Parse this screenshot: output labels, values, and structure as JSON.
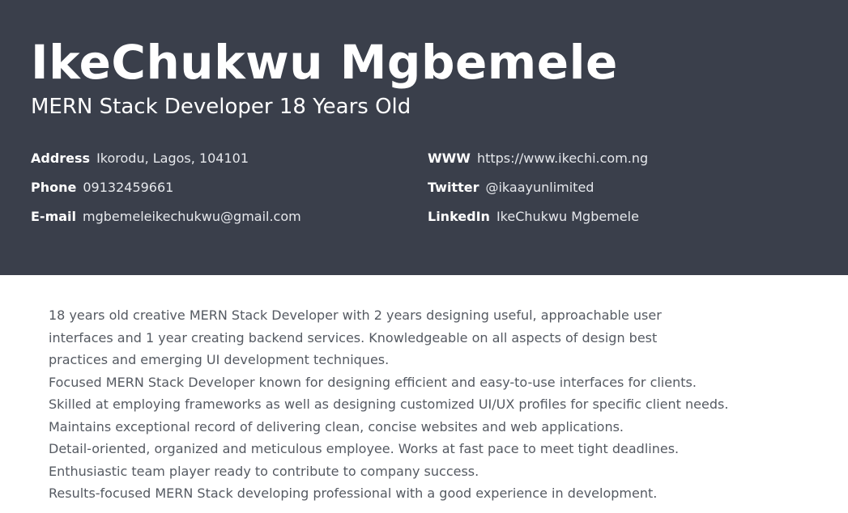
{
  "header": {
    "name": "IkeChukwu Mgbemele",
    "role": "MERN Stack Developer 18 Years Old",
    "background_color": "#3a3f4b",
    "contacts_left": [
      {
        "label": "Address",
        "value": "Ikorodu, Lagos, 104101"
      },
      {
        "label": "Phone",
        "value": "09132459661"
      },
      {
        "label": "E-mail",
        "value": "mgbemeleikechukwu@gmail.com"
      }
    ],
    "contacts_right": [
      {
        "label": "WWW",
        "value": "https://www.ikechi.com.ng"
      },
      {
        "label": "Twitter",
        "value": "@ikaayunlimited"
      },
      {
        "label": "LinkedIn",
        "value": "IkeChukwu Mgbemele"
      }
    ]
  },
  "summary": {
    "lines": [
      "18 years old creative MERN Stack Developer with 2 years designing useful, approachable user",
      "interfaces and 1 year creating backend services. Knowledgeable on all aspects of design best",
      "practices and emerging UI development techniques.",
      "Focused MERN Stack Developer known for designing efficient and easy-to-use interfaces for clients.",
      "Skilled at employing frameworks as well as designing customized UI/UX profiles for specific client needs.",
      "Maintains exceptional record of delivering clean, concise websites and web applications.",
      "Detail-oriented, organized and meticulous employee. Works at fast pace to meet tight deadlines.",
      "Enthusiastic team player ready to contribute to company success.",
      "Results-focused MERN Stack developing professional with a good experience in development."
    ]
  }
}
